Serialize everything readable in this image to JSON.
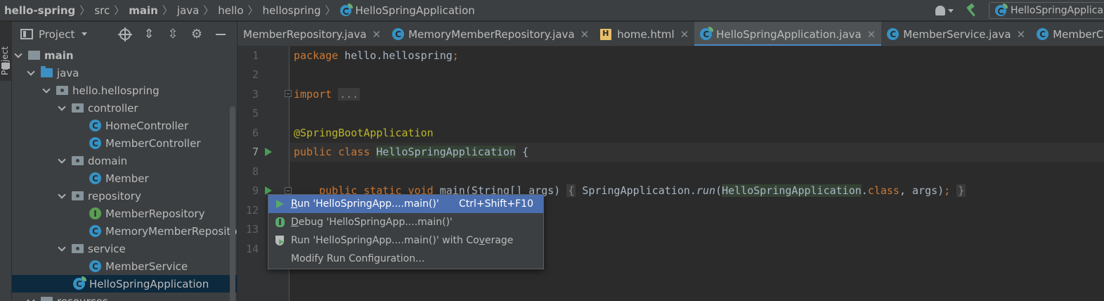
{
  "breadcrumb": {
    "items": [
      "hello-spring",
      "src",
      "main",
      "java",
      "hello",
      "hellospring",
      "HelloSpringApplication"
    ]
  },
  "toolbar": {
    "run_config_label": "HelloSpringApplica",
    "user_icon": "user-icon",
    "build_icon": "hammer-icon"
  },
  "left_strip": {
    "label": "Project"
  },
  "project_panel": {
    "title": "Project",
    "tree": [
      {
        "label": "main",
        "icon": "folder-icon",
        "depth": 0,
        "expanded": true,
        "bold": true
      },
      {
        "label": "java",
        "icon": "source-folder-icon",
        "depth": 1,
        "expanded": true
      },
      {
        "label": "hello.hellospring",
        "icon": "package-icon",
        "depth": 2,
        "expanded": true
      },
      {
        "label": "controller",
        "icon": "package-icon",
        "depth": 3,
        "expanded": true
      },
      {
        "label": "HomeController",
        "icon": "class-icon",
        "depth": 4
      },
      {
        "label": "MemberController",
        "icon": "class-icon",
        "depth": 4
      },
      {
        "label": "domain",
        "icon": "package-icon",
        "depth": 3,
        "expanded": true
      },
      {
        "label": "Member",
        "icon": "class-icon",
        "depth": 4
      },
      {
        "label": "repository",
        "icon": "package-icon",
        "depth": 3,
        "expanded": true
      },
      {
        "label": "MemberRepository",
        "icon": "interface-icon",
        "depth": 4
      },
      {
        "label": "MemoryMemberRepository",
        "icon": "class-icon",
        "depth": 4
      },
      {
        "label": "service",
        "icon": "package-icon",
        "depth": 3,
        "expanded": true
      },
      {
        "label": "MemberService",
        "icon": "class-icon",
        "depth": 4
      },
      {
        "label": "HelloSpringApplication",
        "icon": "spring-class-icon",
        "depth": 3,
        "selected": true
      },
      {
        "label": "resources",
        "icon": "folder-icon",
        "depth": 1,
        "expanded": true
      }
    ]
  },
  "tabs": [
    {
      "label": "MemberRepository.java",
      "icon": "interface-icon"
    },
    {
      "label": "MemoryMemberRepository.java",
      "icon": "class-icon"
    },
    {
      "label": "home.html",
      "icon": "html-icon"
    },
    {
      "label": "HelloSpringApplication.java",
      "icon": "spring-class-icon",
      "active": true
    },
    {
      "label": "MemberService.java",
      "icon": "class-icon"
    },
    {
      "label": "MemberController.java",
      "icon": "class-icon"
    }
  ],
  "editor": {
    "line_numbers": [
      "1",
      "2",
      "3",
      "5",
      "6",
      "7",
      "8",
      "9",
      "12",
      "13",
      "14"
    ],
    "current_line": "7",
    "code": {
      "l1_kw": "package",
      "l1_rest": " hello.hellospring",
      "l1_semi": ";",
      "l3_kw": "import",
      "l3_fold": "...",
      "l6_ann": "@SpringBootApplication",
      "l7_kw": "public class",
      "l7_name": "HelloSpringApplication",
      "l7_rest": " {",
      "l9_kw": "public static void",
      "l9_a": " main(String[] args) ",
      "l9_brace_open": "{",
      "l9_b": " SpringApplication.",
      "l9_run": "run",
      "l9_c": "(",
      "l9_cls": "HelloSpringApplication",
      "l9_dot": ".",
      "l9_classkw": "class",
      "l9_d": ", args)",
      "l9_semi": ";",
      "l9_brace_close": "}"
    }
  },
  "context_menu": {
    "items": [
      {
        "label_u": "R",
        "label": "un 'HelloSpringApp....main()'",
        "shortcut": "Ctrl+Shift+F10",
        "icon": "run-icon",
        "selected": true
      },
      {
        "label_u": "D",
        "label": "ebug 'HelloSpringApp....main()'",
        "icon": "debug-icon"
      },
      {
        "label": "Run 'HelloSpringApp....main()' with Co",
        "label_u": "v",
        "label_tail": "erage",
        "icon": "coverage-icon"
      },
      {
        "label": "Modify Run Configuration..."
      }
    ]
  }
}
